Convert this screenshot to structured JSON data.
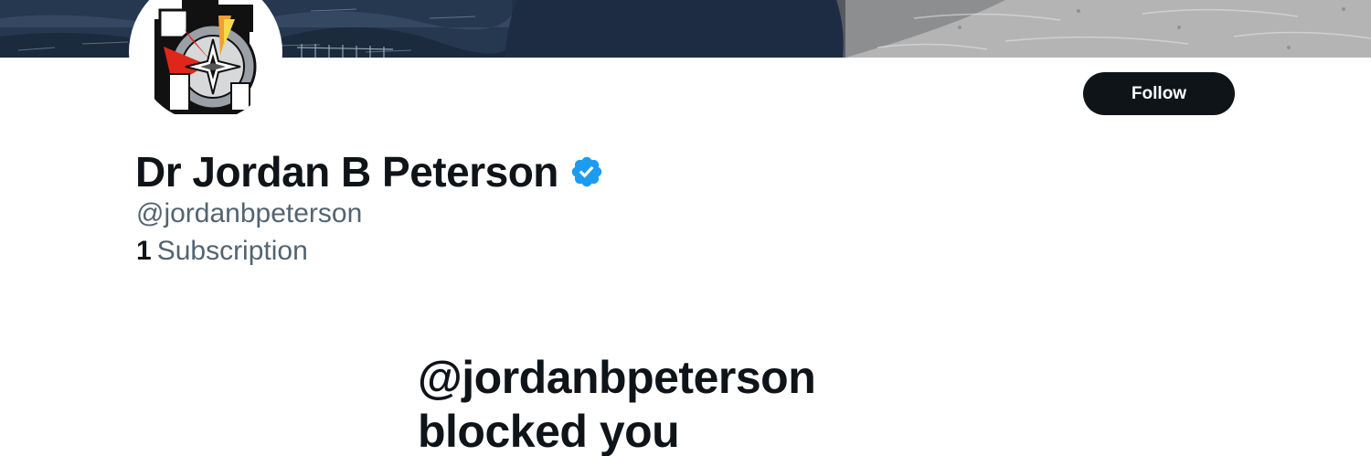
{
  "profile": {
    "display_name": "Dr Jordan B Peterson",
    "handle": "@jordanbpeterson",
    "subscription_count": "1",
    "subscription_label": "Subscription",
    "verified": true,
    "verified_color": "#1d9bf0"
  },
  "actions": {
    "follow_label": "Follow"
  },
  "blocked_notice": {
    "line1": "@jordanbpeterson",
    "line2": "blocked you"
  },
  "icons": {
    "verified": "verified-badge-icon",
    "avatar": "compass-logo-avatar"
  },
  "colors": {
    "text_primary": "#0f1419",
    "text_secondary": "#536471",
    "button_bg": "#0f1419",
    "button_text": "#ffffff"
  }
}
